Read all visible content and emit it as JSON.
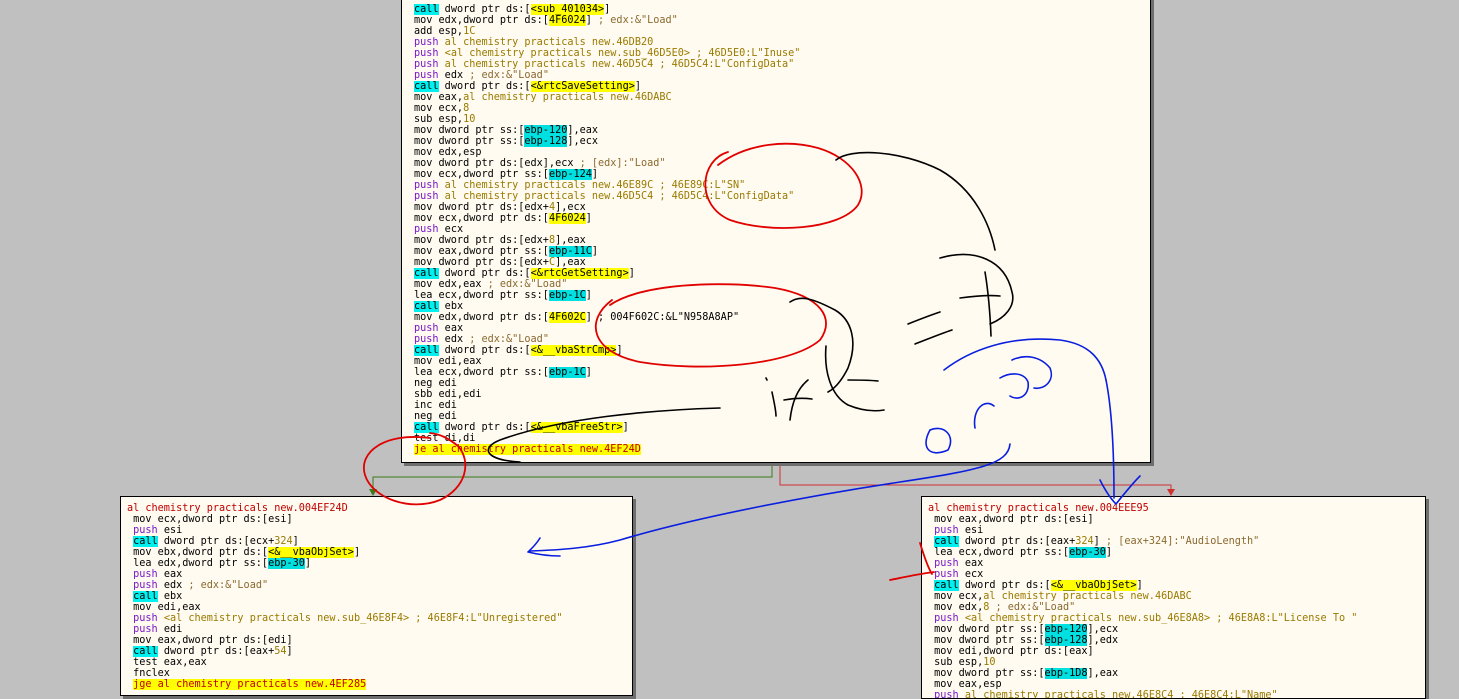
{
  "colors": {
    "background": "#c0c0c0",
    "block_bg": "#fffbf0",
    "header": "#c00000",
    "push": "#7a17c8",
    "call_bg": "#00f0f0",
    "jump_bg": "#ffff00",
    "immediate": "#9a7a00",
    "comment": "#8a6a30",
    "edge_true": "#3a7a1a",
    "edge_false": "#d03030",
    "pen_red": "#e00000",
    "pen_black": "#000000",
    "pen_blue": "#0a1ee0"
  },
  "top_block": {
    "lines": [
      [
        {
          "c": "call",
          "t": "call"
        },
        {
          "c": "pl",
          "t": " dword ptr ds:["
        },
        {
          "c": "yb",
          "t": "<sub_401034>"
        },
        {
          "c": "pl",
          "t": "]"
        }
      ],
      [
        {
          "c": "pl",
          "t": "mov edx,dword ptr ds:["
        },
        {
          "c": "yb",
          "t": "4F6024"
        },
        {
          "c": "pl",
          "t": "] "
        },
        {
          "c": "cm",
          "t": "; edx:&\"Load\""
        }
      ],
      [
        {
          "c": "pl",
          "t": "add esp,"
        },
        {
          "c": "imm",
          "t": "1C"
        }
      ],
      [
        {
          "c": "push",
          "t": "push"
        },
        {
          "c": "imm",
          "t": " al chemistry practicals new.46DB20"
        }
      ],
      [
        {
          "c": "push",
          "t": "push"
        },
        {
          "c": "imm",
          "t": " <al chemistry practicals new.sub_46D5E0> ; 46D5E0:L\"Inuse\""
        }
      ],
      [
        {
          "c": "push",
          "t": "push"
        },
        {
          "c": "imm",
          "t": " al chemistry practicals new.46D5C4 ; 46D5C4:L\"ConfigData\""
        }
      ],
      [
        {
          "c": "push",
          "t": "push"
        },
        {
          "c": "pl",
          "t": " edx "
        },
        {
          "c": "cm",
          "t": "; edx:&\"Load\""
        }
      ],
      [
        {
          "c": "call",
          "t": "call"
        },
        {
          "c": "pl",
          "t": " dword ptr ds:["
        },
        {
          "c": "yb",
          "t": "<&rtcSaveSetting>"
        },
        {
          "c": "pl",
          "t": "]"
        }
      ],
      [
        {
          "c": "pl",
          "t": "mov eax,"
        },
        {
          "c": "imm",
          "t": "al chemistry practicals new.46DABC"
        }
      ],
      [
        {
          "c": "pl",
          "t": "mov ecx,"
        },
        {
          "c": "imm",
          "t": "8"
        }
      ],
      [
        {
          "c": "pl",
          "t": "sub esp,"
        },
        {
          "c": "imm",
          "t": "10"
        }
      ],
      [
        {
          "c": "pl",
          "t": "mov dword ptr ss:["
        },
        {
          "c": "sq",
          "t": "ebp-120"
        },
        {
          "c": "pl",
          "t": "],eax"
        }
      ],
      [
        {
          "c": "pl",
          "t": "mov dword ptr ss:["
        },
        {
          "c": "sq",
          "t": "ebp-128"
        },
        {
          "c": "pl",
          "t": "],ecx"
        }
      ],
      [
        {
          "c": "pl",
          "t": "mov edx,esp"
        }
      ],
      [
        {
          "c": "pl",
          "t": "mov dword ptr ds:[edx],ecx "
        },
        {
          "c": "cm",
          "t": "; [edx]:\"Load\""
        }
      ],
      [
        {
          "c": "pl",
          "t": "mov ecx,dword ptr ss:["
        },
        {
          "c": "sq",
          "t": "ebp-124"
        },
        {
          "c": "pl",
          "t": "]"
        }
      ],
      [
        {
          "c": "push",
          "t": "push"
        },
        {
          "c": "imm",
          "t": " al chemistry practicals new.46E89C ; 46E89C:L\"SN\""
        }
      ],
      [
        {
          "c": "push",
          "t": "push"
        },
        {
          "c": "imm",
          "t": " al chemistry practicals new.46D5C4 ; 46D5C4:L\"ConfigData\""
        }
      ],
      [
        {
          "c": "pl",
          "t": "mov dword ptr ds:[edx+"
        },
        {
          "c": "imm",
          "t": "4"
        },
        {
          "c": "pl",
          "t": "],ecx"
        }
      ],
      [
        {
          "c": "pl",
          "t": "mov ecx,dword ptr ds:["
        },
        {
          "c": "yb",
          "t": "4F6024"
        },
        {
          "c": "pl",
          "t": "]"
        }
      ],
      [
        {
          "c": "push",
          "t": "push"
        },
        {
          "c": "pl",
          "t": " ecx"
        }
      ],
      [
        {
          "c": "pl",
          "t": "mov dword ptr ds:[edx+"
        },
        {
          "c": "imm",
          "t": "8"
        },
        {
          "c": "pl",
          "t": "],eax"
        }
      ],
      [
        {
          "c": "pl",
          "t": "mov eax,dword ptr ss:["
        },
        {
          "c": "sq",
          "t": "ebp-11C"
        },
        {
          "c": "pl",
          "t": "]"
        }
      ],
      [
        {
          "c": "pl",
          "t": "mov dword ptr ds:[edx+"
        },
        {
          "c": "imm",
          "t": "C"
        },
        {
          "c": "pl",
          "t": "],eax"
        }
      ],
      [
        {
          "c": "call",
          "t": "call"
        },
        {
          "c": "pl",
          "t": " dword ptr ds:["
        },
        {
          "c": "yb",
          "t": "<&rtcGetSetting>"
        },
        {
          "c": "pl",
          "t": "]"
        }
      ],
      [
        {
          "c": "pl",
          "t": "mov edx,eax "
        },
        {
          "c": "cm",
          "t": "; edx:&\"Load\""
        }
      ],
      [
        {
          "c": "pl",
          "t": "lea ecx,dword ptr ss:["
        },
        {
          "c": "sq",
          "t": "ebp-1C"
        },
        {
          "c": "pl",
          "t": "]"
        }
      ],
      [
        {
          "c": "call",
          "t": "call"
        },
        {
          "c": "pl",
          "t": " ebx"
        }
      ],
      [
        {
          "c": "pl",
          "t": "mov edx,dword ptr ds:["
        },
        {
          "c": "yb",
          "t": "4F602C"
        },
        {
          "c": "pl",
          "t": "] ; 004F602C:&L\"N958A8AP\""
        }
      ],
      [
        {
          "c": "push",
          "t": "push"
        },
        {
          "c": "pl",
          "t": " eax"
        }
      ],
      [
        {
          "c": "push",
          "t": "push"
        },
        {
          "c": "pl",
          "t": " edx "
        },
        {
          "c": "cm",
          "t": "; edx:&\"Load\""
        }
      ],
      [
        {
          "c": "call",
          "t": "call"
        },
        {
          "c": "pl",
          "t": " dword ptr ds:["
        },
        {
          "c": "yb",
          "t": "<&__vbaStrCmp>"
        },
        {
          "c": "pl",
          "t": "]"
        }
      ],
      [
        {
          "c": "pl",
          "t": "mov edi,eax"
        }
      ],
      [
        {
          "c": "pl",
          "t": "lea ecx,dword ptr ss:["
        },
        {
          "c": "sq",
          "t": "ebp-1C"
        },
        {
          "c": "pl",
          "t": "]"
        }
      ],
      [
        {
          "c": "pl",
          "t": "neg edi"
        }
      ],
      [
        {
          "c": "pl",
          "t": "sbb edi,edi"
        }
      ],
      [
        {
          "c": "pl",
          "t": "inc edi"
        }
      ],
      [
        {
          "c": "pl",
          "t": "neg edi"
        }
      ],
      [
        {
          "c": "call",
          "t": "call"
        },
        {
          "c": "pl",
          "t": " dword ptr ds:["
        },
        {
          "c": "yb",
          "t": "<&__vbaFreeStr>"
        },
        {
          "c": "pl",
          "t": "]"
        }
      ],
      [
        {
          "c": "pl",
          "t": "test di,di"
        }
      ],
      [
        {
          "c": "jmp",
          "t": "je al chemistry practicals new.4EF24D"
        }
      ]
    ]
  },
  "left_block": {
    "lines": [
      [
        {
          "c": "hdr",
          "t": "al chemistry practicals new.004EF24D"
        }
      ],
      [
        {
          "c": "pl",
          "t": " mov ecx,dword ptr ds:[esi]"
        }
      ],
      [
        {
          "c": "pl",
          "t": " "
        },
        {
          "c": "push",
          "t": "push"
        },
        {
          "c": "pl",
          "t": " esi"
        }
      ],
      [
        {
          "c": "pl",
          "t": " "
        },
        {
          "c": "call",
          "t": "call"
        },
        {
          "c": "pl",
          "t": " dword ptr ds:[ecx+"
        },
        {
          "c": "imm",
          "t": "324"
        },
        {
          "c": "pl",
          "t": "]"
        }
      ],
      [
        {
          "c": "pl",
          "t": " mov ebx,dword ptr ds:["
        },
        {
          "c": "yb",
          "t": "<&__vbaObjSet>"
        },
        {
          "c": "pl",
          "t": "]"
        }
      ],
      [
        {
          "c": "pl",
          "t": " lea edx,dword ptr ss:["
        },
        {
          "c": "sq",
          "t": "ebp-30"
        },
        {
          "c": "pl",
          "t": "]"
        }
      ],
      [
        {
          "c": "pl",
          "t": " "
        },
        {
          "c": "push",
          "t": "push"
        },
        {
          "c": "pl",
          "t": " eax"
        }
      ],
      [
        {
          "c": "pl",
          "t": " "
        },
        {
          "c": "push",
          "t": "push"
        },
        {
          "c": "pl",
          "t": " edx "
        },
        {
          "c": "cm",
          "t": "; edx:&\"Load\""
        }
      ],
      [
        {
          "c": "pl",
          "t": " "
        },
        {
          "c": "call",
          "t": "call"
        },
        {
          "c": "pl",
          "t": " ebx"
        }
      ],
      [
        {
          "c": "pl",
          "t": " mov edi,eax"
        }
      ],
      [
        {
          "c": "pl",
          "t": " "
        },
        {
          "c": "push",
          "t": "push"
        },
        {
          "c": "imm",
          "t": " <al chemistry practicals new.sub_46E8F4> ; 46E8F4:L\"Unregistered\""
        }
      ],
      [
        {
          "c": "pl",
          "t": " "
        },
        {
          "c": "push",
          "t": "push"
        },
        {
          "c": "pl",
          "t": " edi"
        }
      ],
      [
        {
          "c": "pl",
          "t": " mov eax,dword ptr ds:[edi]"
        }
      ],
      [
        {
          "c": "pl",
          "t": " "
        },
        {
          "c": "call",
          "t": "call"
        },
        {
          "c": "pl",
          "t": " dword ptr ds:[eax+"
        },
        {
          "c": "imm",
          "t": "54"
        },
        {
          "c": "pl",
          "t": "]"
        }
      ],
      [
        {
          "c": "pl",
          "t": " test eax,eax"
        }
      ],
      [
        {
          "c": "pl",
          "t": " fnclex"
        }
      ],
      [
        {
          "c": "pl",
          "t": " "
        },
        {
          "c": "jmp",
          "t": "jge al chemistry practicals new.4EF285"
        }
      ]
    ]
  },
  "right_block": {
    "lines": [
      [
        {
          "c": "hdr",
          "t": "al chemistry practicals new.004EEE95"
        }
      ],
      [
        {
          "c": "pl",
          "t": " mov eax,dword ptr ds:[esi]"
        }
      ],
      [
        {
          "c": "pl",
          "t": " "
        },
        {
          "c": "push",
          "t": "push"
        },
        {
          "c": "pl",
          "t": " esi"
        }
      ],
      [
        {
          "c": "pl",
          "t": " "
        },
        {
          "c": "call",
          "t": "call"
        },
        {
          "c": "pl",
          "t": " dword ptr ds:[eax+"
        },
        {
          "c": "imm",
          "t": "324"
        },
        {
          "c": "pl",
          "t": "] "
        },
        {
          "c": "cm",
          "t": "; [eax+324]:\"AudioLength\""
        }
      ],
      [
        {
          "c": "pl",
          "t": " lea ecx,dword ptr ss:["
        },
        {
          "c": "sq",
          "t": "ebp-30"
        },
        {
          "c": "pl",
          "t": "]"
        }
      ],
      [
        {
          "c": "pl",
          "t": " "
        },
        {
          "c": "push",
          "t": "push"
        },
        {
          "c": "pl",
          "t": " eax"
        }
      ],
      [
        {
          "c": "pl",
          "t": " "
        },
        {
          "c": "push",
          "t": "push"
        },
        {
          "c": "pl",
          "t": " ecx"
        }
      ],
      [
        {
          "c": "pl",
          "t": " "
        },
        {
          "c": "call",
          "t": "call"
        },
        {
          "c": "pl",
          "t": " dword ptr ds:["
        },
        {
          "c": "yb",
          "t": "<&__vbaObjSet>"
        },
        {
          "c": "pl",
          "t": "]"
        }
      ],
      [
        {
          "c": "pl",
          "t": " mov ecx,"
        },
        {
          "c": "imm",
          "t": "al chemistry practicals new.46DABC"
        }
      ],
      [
        {
          "c": "pl",
          "t": " mov edx,"
        },
        {
          "c": "imm",
          "t": "8"
        },
        {
          "c": "pl",
          "t": " "
        },
        {
          "c": "cm",
          "t": "; edx:&\"Load\""
        }
      ],
      [
        {
          "c": "pl",
          "t": " "
        },
        {
          "c": "push",
          "t": "push"
        },
        {
          "c": "imm",
          "t": " <al chemistry practicals new.sub_46E8A8> ; 46E8A8:L\"License To \""
        }
      ],
      [
        {
          "c": "pl",
          "t": " mov dword ptr ss:["
        },
        {
          "c": "sq",
          "t": "ebp-120"
        },
        {
          "c": "pl",
          "t": "],ecx"
        }
      ],
      [
        {
          "c": "pl",
          "t": " mov dword ptr ss:["
        },
        {
          "c": "sq",
          "t": "ebp-128"
        },
        {
          "c": "pl",
          "t": "],edx"
        }
      ],
      [
        {
          "c": "pl",
          "t": " mov edi,dword ptr ds:[eax]"
        }
      ],
      [
        {
          "c": "pl",
          "t": " sub esp,"
        },
        {
          "c": "imm",
          "t": "10"
        }
      ],
      [
        {
          "c": "pl",
          "t": " mov dword ptr ss:["
        },
        {
          "c": "sq",
          "t": "ebp-1D8"
        },
        {
          "c": "pl",
          "t": "],eax"
        }
      ],
      [
        {
          "c": "pl",
          "t": " mov eax,esp"
        }
      ],
      [
        {
          "c": "pl",
          "t": " "
        },
        {
          "c": "push",
          "t": "push"
        },
        {
          "c": "imm",
          "t": " al chemistry practicals new.46E8C4 ; 46E8C4:L\"Name\""
        }
      ]
    ]
  }
}
